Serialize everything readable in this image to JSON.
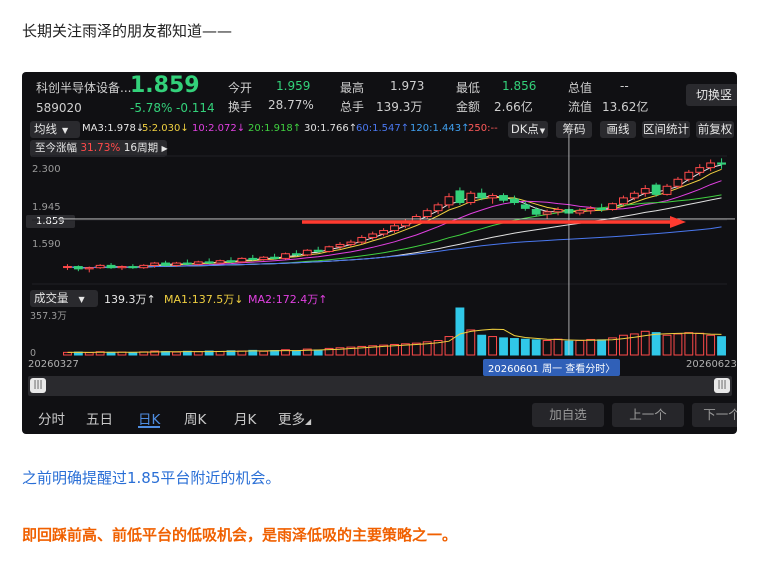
{
  "intro": "长期关注雨泽的朋友都知道——",
  "stock": {
    "name": "科创半导体设备...",
    "code": "589020",
    "price": "1.859",
    "change_pct": "-5.78%",
    "change": "-0.114"
  },
  "stats": {
    "open_label": "今开",
    "open": "1.959",
    "high_label": "最高",
    "high": "1.973",
    "low_label": "最低",
    "low": "1.856",
    "total_label": "总值",
    "total": "--",
    "turnover_label": "换手",
    "turnover": "28.77%",
    "vol_label": "总手",
    "vol": "139.3万",
    "amount_label": "金额",
    "amount": "2.66亿",
    "float_label": "流值",
    "float": "13.62亿"
  },
  "switch_button": "切换竖",
  "ma_bar": {
    "selector": "均线",
    "ma3": "MA3:1.978↓",
    "ma5": "5:2.030↓",
    "ma10": "10:2.072↓",
    "ma20": "20:1.918↑",
    "ma30": "30:1.766↑",
    "ma60": "60:1.547↑",
    "ma120": "120:1.443↑",
    "ma250": "250:--"
  },
  "toolbar": {
    "dk": "DK点",
    "chip": "筹码",
    "draw": "画线",
    "range_stat": "区间统计",
    "adjust": "前复权"
  },
  "gain": {
    "label": "至今涨幅",
    "value": "31.73%",
    "period": "16周期"
  },
  "price_axis": {
    "p1": "2.300",
    "p2": "1.945",
    "current": "1.859",
    "p3": "1.590"
  },
  "volume_bar": {
    "selector": "成交量",
    "vol": "139.3万↑",
    "ma1": "MA1:137.5万↓",
    "ma2": "MA2:172.4万↑",
    "max": "357.3万",
    "zero": "0"
  },
  "dates": {
    "start": "20260327",
    "cursor": "20260601 周一 查看分时〉",
    "end": "20260623"
  },
  "periods": {
    "minute": "分时",
    "day5": "五日",
    "day": "日K",
    "week": "周K",
    "month": "月K",
    "more": "更多"
  },
  "actions": {
    "add": "加自选",
    "prev": "上一个",
    "next": "下一个"
  },
  "colors": {
    "up": "#ff4a4a",
    "down": "#33d17a",
    "selected_tab": "#4f8de0",
    "arrow": "#ff3b30"
  },
  "chart_data": {
    "type": "candlestick",
    "ylim": [
      1.3,
      2.4
    ],
    "candles": [
      [
        1.45,
        1.47,
        1.42,
        1.45
      ],
      [
        1.45,
        1.46,
        1.41,
        1.43
      ],
      [
        1.43,
        1.45,
        1.4,
        1.44
      ],
      [
        1.44,
        1.47,
        1.43,
        1.46
      ],
      [
        1.46,
        1.48,
        1.43,
        1.44
      ],
      [
        1.44,
        1.46,
        1.42,
        1.45
      ],
      [
        1.45,
        1.47,
        1.43,
        1.44
      ],
      [
        1.44,
        1.47,
        1.43,
        1.46
      ],
      [
        1.46,
        1.49,
        1.44,
        1.48
      ],
      [
        1.48,
        1.5,
        1.45,
        1.46
      ],
      [
        1.46,
        1.49,
        1.45,
        1.48
      ],
      [
        1.48,
        1.51,
        1.46,
        1.47
      ],
      [
        1.47,
        1.5,
        1.46,
        1.49
      ],
      [
        1.49,
        1.52,
        1.47,
        1.48
      ],
      [
        1.48,
        1.51,
        1.47,
        1.5
      ],
      [
        1.5,
        1.53,
        1.48,
        1.49
      ],
      [
        1.49,
        1.53,
        1.48,
        1.52
      ],
      [
        1.52,
        1.55,
        1.5,
        1.51
      ],
      [
        1.51,
        1.54,
        1.5,
        1.53
      ],
      [
        1.53,
        1.56,
        1.51,
        1.52
      ],
      [
        1.52,
        1.57,
        1.51,
        1.56
      ],
      [
        1.56,
        1.59,
        1.54,
        1.55
      ],
      [
        1.55,
        1.6,
        1.54,
        1.59
      ],
      [
        1.59,
        1.62,
        1.57,
        1.58
      ],
      [
        1.58,
        1.63,
        1.57,
        1.62
      ],
      [
        1.62,
        1.66,
        1.6,
        1.64
      ],
      [
        1.64,
        1.68,
        1.62,
        1.66
      ],
      [
        1.66,
        1.72,
        1.64,
        1.7
      ],
      [
        1.7,
        1.75,
        1.68,
        1.73
      ],
      [
        1.73,
        1.78,
        1.71,
        1.76
      ],
      [
        1.76,
        1.82,
        1.74,
        1.8
      ],
      [
        1.8,
        1.86,
        1.78,
        1.84
      ],
      [
        1.84,
        1.9,
        1.82,
        1.88
      ],
      [
        1.88,
        1.95,
        1.86,
        1.93
      ],
      [
        1.93,
        2.0,
        1.9,
        1.98
      ],
      [
        1.98,
        2.08,
        1.95,
        2.05
      ],
      [
        2.1,
        2.13,
        1.98,
        2.0
      ],
      [
        2.0,
        2.1,
        1.98,
        2.08
      ],
      [
        2.08,
        2.12,
        2.02,
        2.04
      ],
      [
        2.04,
        2.08,
        1.99,
        2.06
      ],
      [
        2.06,
        2.08,
        2.0,
        2.02
      ],
      [
        2.03,
        2.06,
        1.98,
        2.0
      ],
      [
        1.98,
        2.01,
        1.93,
        1.95
      ],
      [
        1.94,
        1.96,
        1.88,
        1.9
      ],
      [
        1.9,
        1.94,
        1.86,
        1.92
      ],
      [
        1.92,
        1.96,
        1.89,
        1.94
      ],
      [
        1.94,
        1.96,
        1.9,
        1.91
      ],
      [
        1.91,
        1.95,
        1.89,
        1.93
      ],
      [
        1.93,
        1.97,
        1.9,
        1.95
      ],
      [
        1.95,
        1.99,
        1.92,
        1.94
      ],
      [
        1.94,
        2.0,
        1.93,
        1.99
      ],
      [
        1.99,
        2.06,
        1.97,
        2.04
      ],
      [
        2.04,
        2.1,
        2.02,
        2.08
      ],
      [
        2.08,
        2.15,
        2.05,
        2.12
      ],
      [
        2.15,
        2.17,
        2.05,
        2.07
      ],
      [
        2.07,
        2.16,
        2.06,
        2.14
      ],
      [
        2.14,
        2.22,
        2.12,
        2.2
      ],
      [
        2.2,
        2.28,
        2.18,
        2.26
      ],
      [
        2.26,
        2.33,
        2.23,
        2.3
      ],
      [
        2.3,
        2.37,
        2.27,
        2.34
      ],
      [
        2.34,
        2.38,
        2.29,
        2.33
      ]
    ],
    "volumes": [
      20,
      22,
      18,
      25,
      20,
      22,
      19,
      24,
      30,
      26,
      22,
      28,
      25,
      30,
      27,
      32,
      30,
      35,
      28,
      34,
      40,
      32,
      45,
      38,
      50,
      55,
      60,
      65,
      70,
      75,
      80,
      85,
      90,
      100,
      110,
      140,
      357,
      190,
      150,
      140,
      130,
      125,
      120,
      115,
      110,
      120,
      105,
      110,
      118,
      115,
      130,
      150,
      160,
      180,
      170,
      150,
      160,
      170,
      165,
      150,
      139
    ],
    "cursor_index": 46,
    "horizontal_level": 1.859
  }
}
